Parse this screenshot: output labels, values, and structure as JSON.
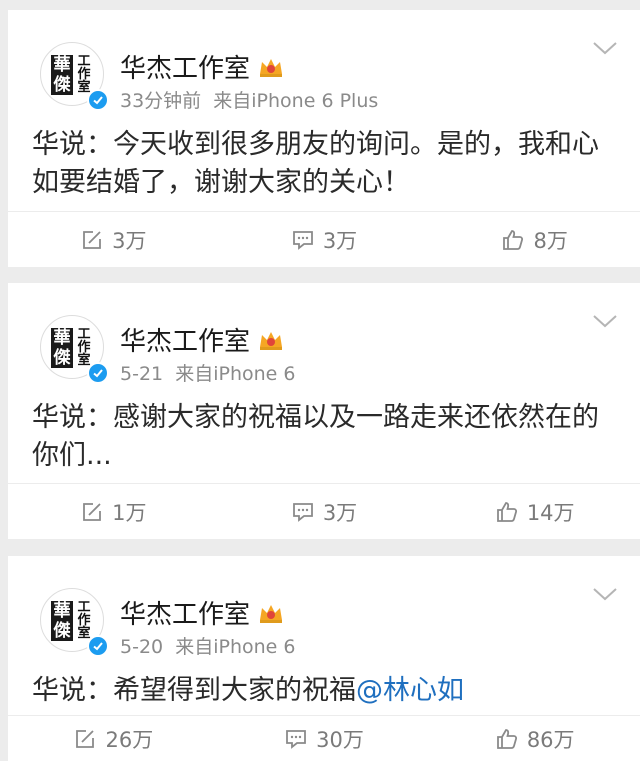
{
  "posts": [
    {
      "author": "华杰工作室",
      "time": "33分钟前",
      "source": "来自iPhone 6 Plus",
      "text": "华说：今天收到很多朋友的询问。是的，我和心如要结婚了，谢谢大家的关心！",
      "mention": "",
      "repost": "3万",
      "comment": "3万",
      "like": "8万"
    },
    {
      "author": "华杰工作室",
      "time": "5-21",
      "source": "来自iPhone 6",
      "text": "华说：感谢大家的祝福以及一路走来还依然在的你们...",
      "mention": "",
      "repost": "1万",
      "comment": "3万",
      "like": "14万"
    },
    {
      "author": "华杰工作室",
      "time": "5-20",
      "source": "来自iPhone 6",
      "text": "华说：希望得到大家的祝福",
      "mention": "@林心如",
      "repost": "26万",
      "comment": "30万",
      "like": "86万"
    }
  ],
  "avatar": {
    "stamp": "華傑",
    "side": "工作室"
  },
  "icons": {
    "repost": "repost-icon",
    "comment": "comment-icon",
    "like": "thumbs-up-icon",
    "verified": "verified-badge-icon",
    "crown": "crown-badge-icon",
    "menu": "chevron-down-icon"
  },
  "colors": {
    "link": "#1f6fbf",
    "verified": "#1c9cf0",
    "crown": "#f5a623"
  }
}
